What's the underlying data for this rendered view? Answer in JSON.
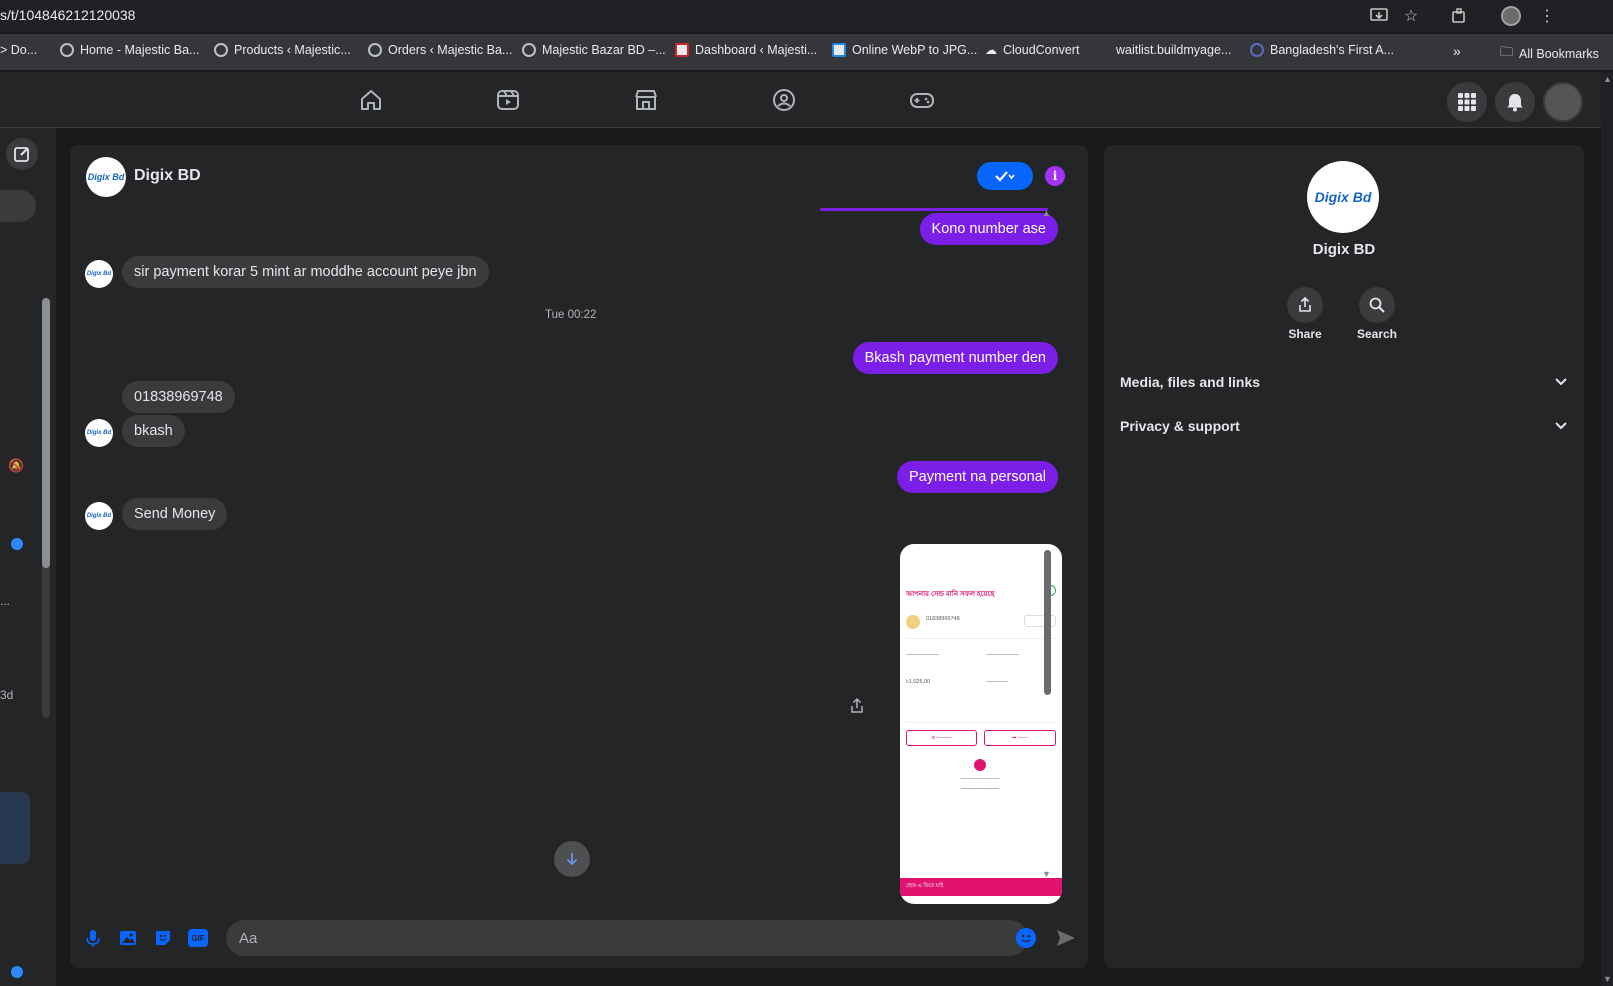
{
  "browser": {
    "url": "s/t/104846212120038",
    "bookmarks": [
      {
        "label": "> Do..."
      },
      {
        "label": "Home - Majestic Ba..."
      },
      {
        "label": "Products ‹ Majestic..."
      },
      {
        "label": "Orders ‹ Majestic Ba..."
      },
      {
        "label": "Majestic Bazar BD –..."
      },
      {
        "label": "Dashboard ‹ Majesti..."
      },
      {
        "label": "Online WebP to JPG..."
      },
      {
        "label": "CloudConvert"
      },
      {
        "label": "waitlist.buildmyage..."
      },
      {
        "label": "Bangladesh's First A..."
      }
    ],
    "more_bookmarks": "»",
    "all_bookmarks": "All Bookmarks"
  },
  "left_rail": {
    "label_ellipsis": "...",
    "label_3d": "3d"
  },
  "chat": {
    "contact_name": "Digix BD",
    "logo_text": "Digix Bd",
    "messages": {
      "out_1": "Kono number ase",
      "in_1": "sir payment korar 5 mint ar moddhe account peye jbn",
      "timestamp": "Tue 00:22",
      "out_2": "Bkash payment number den",
      "in_2": "01838969748",
      "in_3": "bkash",
      "out_3": "Payment na personal",
      "in_4": "Send Money"
    },
    "receipt": {
      "title": "আপনার সেন্ড মানি সফল হয়েছে",
      "number": "01838969748",
      "amount_label": "৳1,025.00",
      "footer": "হোম-এ ফিরে যাই"
    },
    "composer_placeholder": "Aa"
  },
  "info_panel": {
    "name": "Digix BD",
    "actions": {
      "share": "Share",
      "search": "Search"
    },
    "sections": {
      "media": "Media, files and links",
      "privacy": "Privacy & support"
    }
  },
  "colors": {
    "outgoing_bubble": "#7b1fe8",
    "incoming_bubble": "#3a3b3c",
    "accent": "#0866ff"
  }
}
